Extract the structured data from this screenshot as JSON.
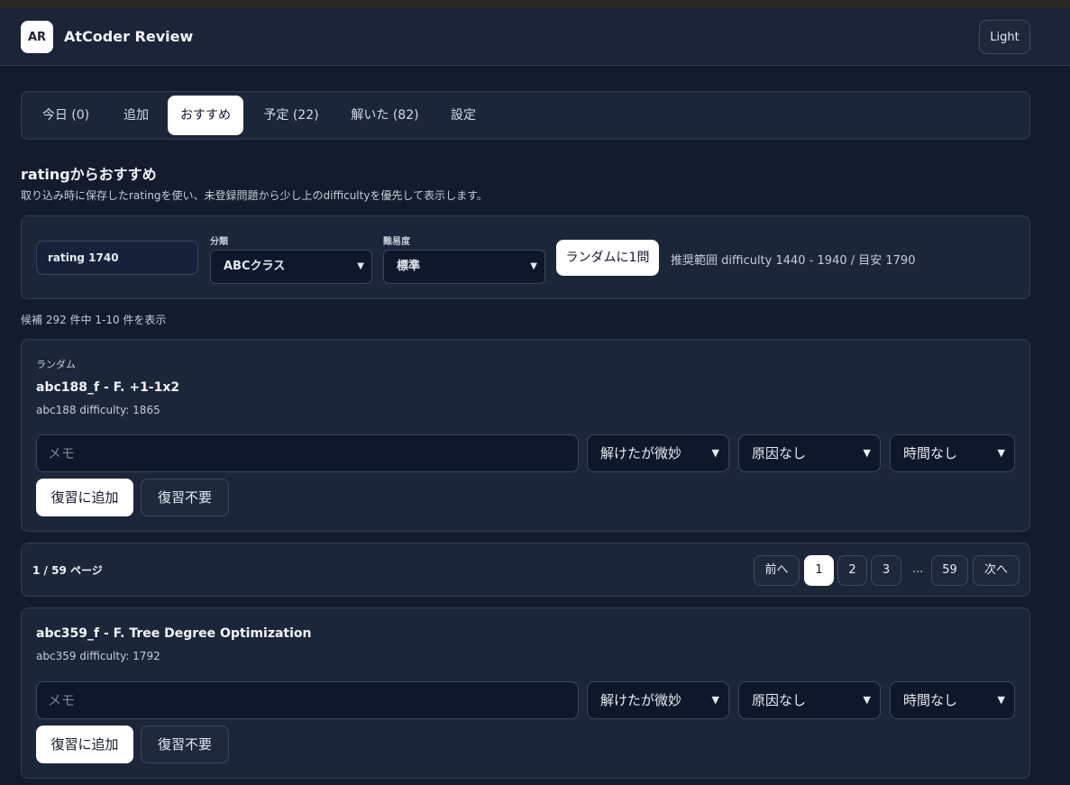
{
  "header": {
    "logo_text": "AR",
    "title": "AtCoder Review",
    "theme_label": "Light"
  },
  "tabs": [
    {
      "label": "今日 (0)"
    },
    {
      "label": "追加"
    },
    {
      "label": "おすすめ",
      "active": true
    },
    {
      "label": "予定 (22)"
    },
    {
      "label": "解いた (82)"
    },
    {
      "label": "設定"
    }
  ],
  "section": {
    "title": "ratingからおすすめ",
    "description": "取り込み時に保存したratingを使い、未登録問題から少し上のdifficultyを優先して表示します。"
  },
  "filter": {
    "rating": "rating 1740",
    "category_label": "分類",
    "category_value": "ABCクラス",
    "difficulty_label": "難易度",
    "difficulty_value": "標準",
    "random_label": "ランダムに1問",
    "range_text": "推奨範囲 difficulty 1440 - 1940 / 目安 1790"
  },
  "count_text": "候補 292 件中 1-10 件を表示",
  "random_card": {
    "tag": "ランダム",
    "title": "abc188_f - F. +1-1x2",
    "meta": "abc188  difficulty: 1865",
    "memo_placeholder": "メモ",
    "select_solved": "解けたが微妙",
    "select_cause": "原因なし",
    "select_time": "時間なし",
    "add_label": "復習に追加",
    "skip_label": "復習不要"
  },
  "pager": {
    "info": "1 / 59 ページ",
    "prev": "前へ",
    "pages": [
      "1",
      "2",
      "3"
    ],
    "ellipsis": "...",
    "last": "59",
    "next": "次へ"
  },
  "problem_cards": [
    {
      "title": "abc359_f - F. Tree Degree Optimization",
      "meta": "abc359  difficulty: 1792",
      "memo_placeholder": "メモ",
      "select_solved": "解けたが微妙",
      "select_cause": "原因なし",
      "select_time": "時間なし",
      "add_label": "復習に追加",
      "skip_label": "復習不要"
    }
  ],
  "colors": {
    "background": "#131b2c",
    "panel": "#1c2639",
    "accent": "#ffffff"
  }
}
